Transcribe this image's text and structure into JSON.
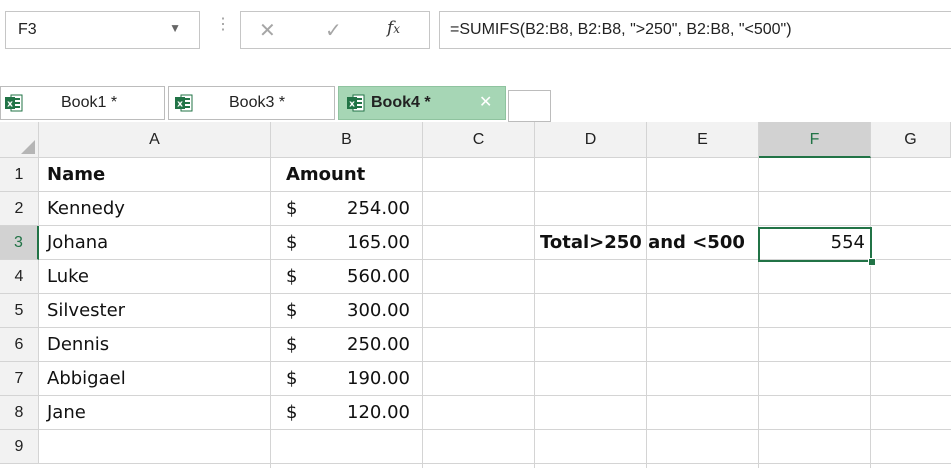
{
  "formula_bar": {
    "name_box": "F3",
    "cancel_icon": "✕",
    "enter_icon": "✓",
    "function_icon": "fx",
    "formula": "=SUMIFS(B2:B8, B2:B8, \">250\", B2:B8, \"<500\")"
  },
  "tabs": [
    {
      "label": "Book1 *",
      "active": false
    },
    {
      "label": "Book3 *",
      "active": false
    },
    {
      "label": "Book4 *",
      "active": true
    }
  ],
  "columns": [
    "A",
    "B",
    "C",
    "D",
    "E",
    "F",
    "G"
  ],
  "rows": [
    "1",
    "2",
    "3",
    "4",
    "5",
    "6",
    "7",
    "8",
    "9"
  ],
  "selected": {
    "column": "F",
    "row": "3"
  },
  "sheet": {
    "header_name": "Name",
    "header_amount": "Amount",
    "currency_symbol": "$",
    "names": [
      "Kennedy",
      "Johana",
      "Luke",
      "Silvester",
      "Dennis",
      "Abbigael",
      "Jane"
    ],
    "amounts": [
      "254.00",
      "165.00",
      "560.00",
      "300.00",
      "250.00",
      "190.00",
      "120.00"
    ],
    "label": "Total>250 and <500",
    "result": "554"
  },
  "colors": {
    "accent": "#217346",
    "active_tab": "#a6d6b5",
    "header_bg": "#f2f2f2"
  }
}
